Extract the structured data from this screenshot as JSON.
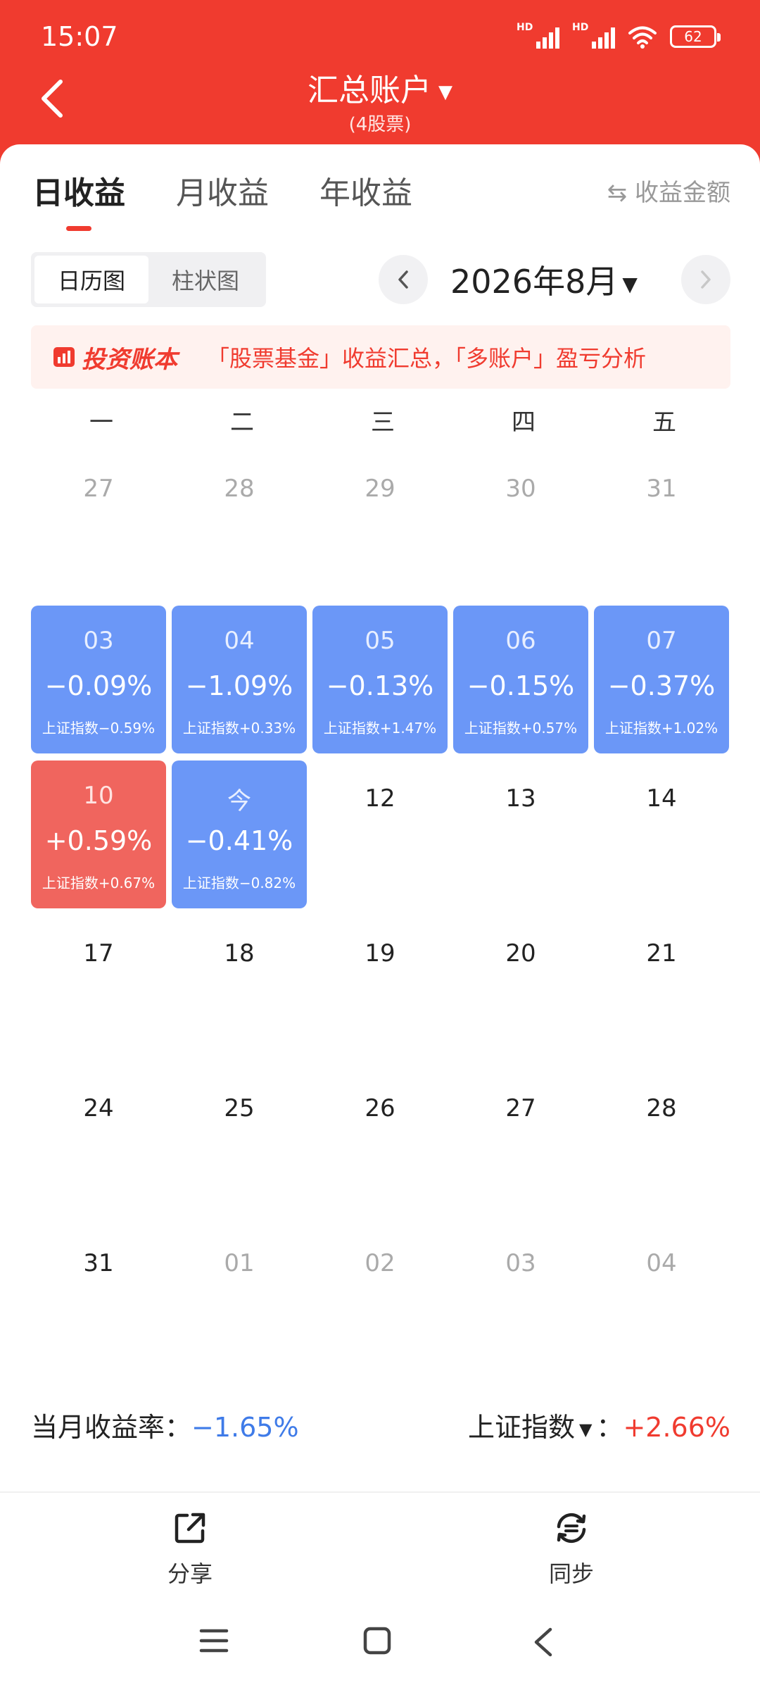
{
  "status": {
    "time": "15:07",
    "hd1": "HD",
    "hd2": "HD",
    "battery": "62"
  },
  "header": {
    "title": "汇总账户",
    "subtitle": "(4股票)"
  },
  "tabs": [
    {
      "label": "日收益",
      "active": true
    },
    {
      "label": "月收益",
      "active": false
    },
    {
      "label": "年收益",
      "active": false
    }
  ],
  "toggle_amount_label": "⇆ 收益金额",
  "view_toggle": {
    "calendar": "日历图",
    "bar": "柱状图"
  },
  "month_selector": {
    "label": "2026年8月"
  },
  "banner": {
    "logo_text": "投资账本",
    "text": "「股票基金」收益汇总，「多账户」盈亏分析"
  },
  "weekdays": [
    "一",
    "二",
    "三",
    "四",
    "五"
  ],
  "calendar": {
    "rows": [
      [
        {
          "day": "27",
          "type": "muted"
        },
        {
          "day": "28",
          "type": "muted"
        },
        {
          "day": "29",
          "type": "muted"
        },
        {
          "day": "30",
          "type": "muted"
        },
        {
          "day": "31",
          "type": "muted"
        }
      ],
      [
        {
          "day": "03",
          "type": "loss",
          "value": "−0.09%",
          "index": "上证指数−0.59%"
        },
        {
          "day": "04",
          "type": "loss",
          "value": "−1.09%",
          "index": "上证指数+0.33%"
        },
        {
          "day": "05",
          "type": "loss",
          "value": "−0.13%",
          "index": "上证指数+1.47%"
        },
        {
          "day": "06",
          "type": "loss",
          "value": "−0.15%",
          "index": "上证指数+0.57%"
        },
        {
          "day": "07",
          "type": "loss",
          "value": "−0.37%",
          "index": "上证指数+1.02%"
        }
      ],
      [
        {
          "day": "10",
          "type": "gain",
          "value": "+0.59%",
          "index": "上证指数+0.67%"
        },
        {
          "day": "今",
          "type": "loss",
          "value": "−0.41%",
          "index": "上证指数−0.82%"
        },
        {
          "day": "12",
          "type": "plain"
        },
        {
          "day": "13",
          "type": "plain"
        },
        {
          "day": "14",
          "type": "plain"
        }
      ],
      [
        {
          "day": "17",
          "type": "plain"
        },
        {
          "day": "18",
          "type": "plain"
        },
        {
          "day": "19",
          "type": "plain"
        },
        {
          "day": "20",
          "type": "plain"
        },
        {
          "day": "21",
          "type": "plain"
        }
      ],
      [
        {
          "day": "24",
          "type": "plain"
        },
        {
          "day": "25",
          "type": "plain"
        },
        {
          "day": "26",
          "type": "plain"
        },
        {
          "day": "27",
          "type": "plain"
        },
        {
          "day": "28",
          "type": "plain"
        }
      ],
      [
        {
          "day": "31",
          "type": "plain"
        },
        {
          "day": "01",
          "type": "muted"
        },
        {
          "day": "02",
          "type": "muted"
        },
        {
          "day": "03",
          "type": "muted"
        },
        {
          "day": "04",
          "type": "muted"
        }
      ]
    ]
  },
  "summary": {
    "monthly_label": "当月收益率：",
    "monthly_value": "−1.65%",
    "index_label": "上证指数",
    "index_sep": "：",
    "index_value": "+2.66%"
  },
  "actions": {
    "share": "分享",
    "sync": "同步"
  },
  "colors": {
    "brand": "#f03b2f",
    "loss": "#6b97f7",
    "gain": "#f0655e"
  },
  "icons": [
    "back-arrow-icon",
    "caret-down-icon",
    "chevron-left-icon",
    "chevron-right-icon",
    "share-icon",
    "sync-icon",
    "menu-icon",
    "home-icon",
    "back-icon",
    "wifi-icon",
    "signal-icon",
    "battery-icon"
  ]
}
